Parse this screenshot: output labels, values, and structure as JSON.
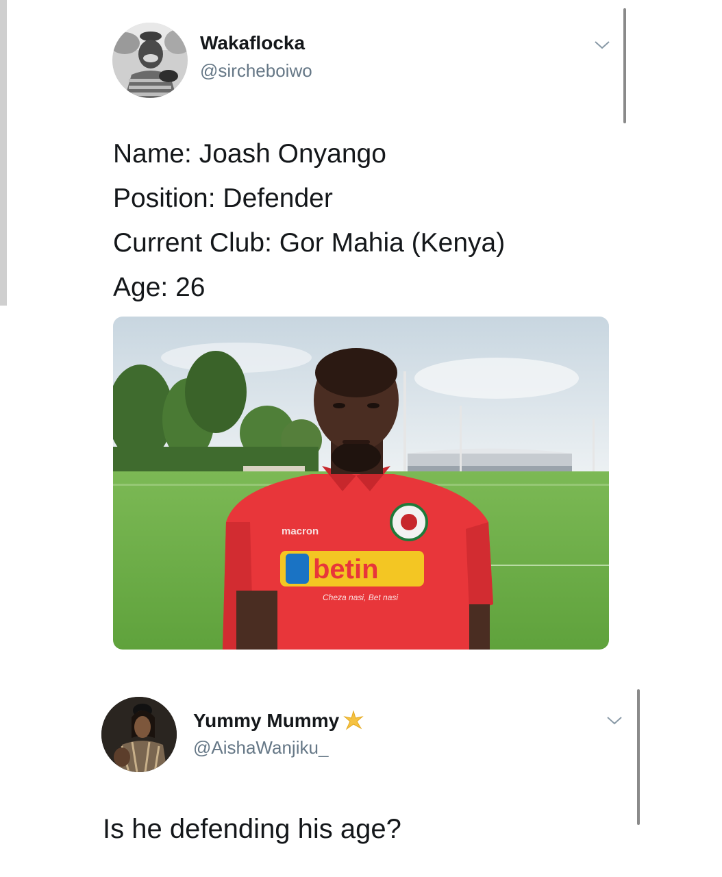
{
  "tweet": {
    "author": {
      "display_name": "Wakaflocka",
      "handle": "@sircheboiwo",
      "avatar_icon": "profile-photo"
    },
    "lines": [
      "Name: Joash Onyango",
      "Position: Defender",
      "Current Club: Gor Mahia (Kenya)",
      "Age: 26"
    ],
    "photo": {
      "brand_small": "macron",
      "brand_main": "betin",
      "tagline": "Cheza nasi, Bet nasi",
      "shirt_color": "#e8363a",
      "grass_color": "#6fb04a",
      "sky_color": "#dfe8ee"
    }
  },
  "reply": {
    "author": {
      "display_name": "Yummy Mummy",
      "handle": "@AishaWanjiku_",
      "badge_icon": "sparkle-icon",
      "avatar_icon": "profile-photo"
    },
    "text": "Is he defending his age?"
  },
  "colors": {
    "text_primary": "#14171a",
    "text_secondary": "#657786",
    "badge": "#f5c242"
  }
}
